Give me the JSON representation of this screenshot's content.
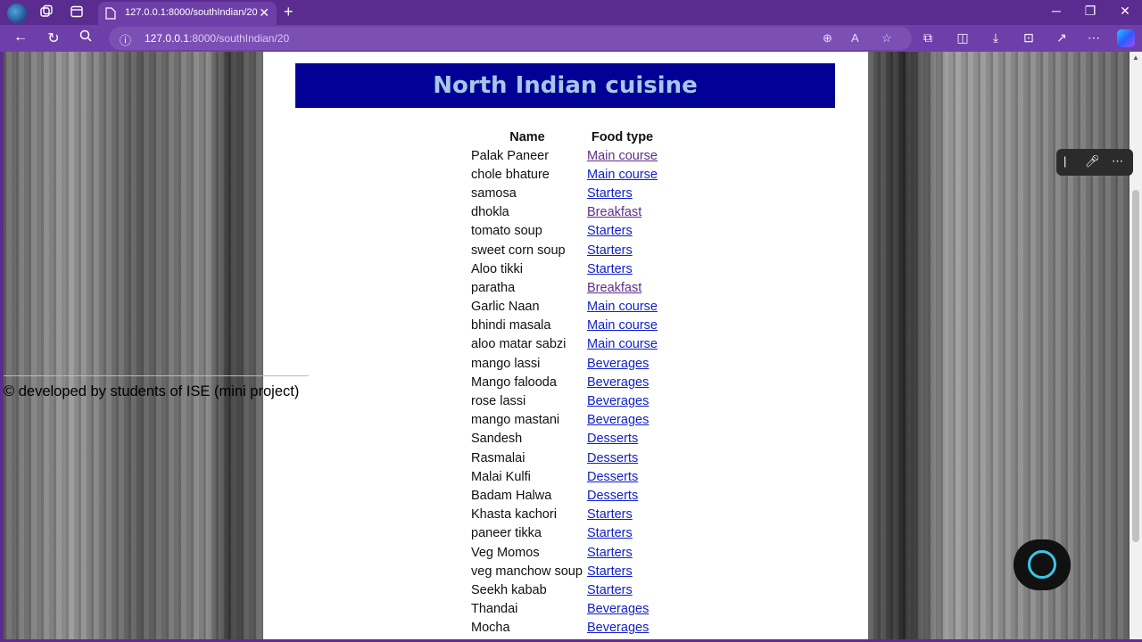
{
  "browser": {
    "tab_title": "127.0.0.1:8000/southIndian/20",
    "url_host": "127.0.0.1",
    "url_rest": ":8000/southIndian/20",
    "new_tab": "+",
    "close_tab": "✕"
  },
  "page": {
    "heading": "North Indian cuisine",
    "columns": [
      "Name",
      "Food type"
    ],
    "rows": [
      {
        "name": "Palak Paneer",
        "type": "Main course",
        "visited": true
      },
      {
        "name": "chole bhature",
        "type": "Main course",
        "visited": false
      },
      {
        "name": "samosa",
        "type": "Starters",
        "visited": false
      },
      {
        "name": "dhokla",
        "type": "Breakfast",
        "visited": true
      },
      {
        "name": "tomato soup",
        "type": "Starters",
        "visited": false
      },
      {
        "name": "sweet corn soup",
        "type": "Starters",
        "visited": false
      },
      {
        "name": "Aloo tikki",
        "type": "Starters",
        "visited": false
      },
      {
        "name": "paratha",
        "type": "Breakfast",
        "visited": true
      },
      {
        "name": "Garlic Naan",
        "type": "Main course",
        "visited": false
      },
      {
        "name": "bhindi masala",
        "type": "Main course",
        "visited": false
      },
      {
        "name": "aloo matar sabzi",
        "type": "Main course",
        "visited": false
      },
      {
        "name": "mango lassi",
        "type": "Beverages",
        "visited": false
      },
      {
        "name": "Mango falooda",
        "type": "Beverages",
        "visited": false
      },
      {
        "name": "rose lassi",
        "type": "Beverages",
        "visited": false
      },
      {
        "name": "mango mastani",
        "type": "Beverages",
        "visited": false
      },
      {
        "name": "Sandesh",
        "type": "Desserts",
        "visited": false
      },
      {
        "name": "Rasmalai",
        "type": "Desserts",
        "visited": false
      },
      {
        "name": "Malai Kulfi",
        "type": "Desserts",
        "visited": false
      },
      {
        "name": "Badam Halwa",
        "type": "Desserts",
        "visited": false
      },
      {
        "name": "Khasta kachori",
        "type": "Starters",
        "visited": false
      },
      {
        "name": "paneer tikka",
        "type": "Starters",
        "visited": false
      },
      {
        "name": "Veg Momos",
        "type": "Starters",
        "visited": false
      },
      {
        "name": "veg manchow soup",
        "type": "Starters",
        "visited": false
      },
      {
        "name": "Seekh kabab",
        "type": "Starters",
        "visited": false
      },
      {
        "name": "Thandai",
        "type": "Beverages",
        "visited": false
      },
      {
        "name": "Mocha",
        "type": "Beverages",
        "visited": false
      }
    ],
    "footer": "© developed by students of ISE (mini project)"
  },
  "colors": {
    "heading_bg": "#010195",
    "heading_text": "#a8c6e8",
    "link": "#0f1fcc",
    "link_visited": "#5f2d8e",
    "browser_frame": "#5b2c8f"
  }
}
